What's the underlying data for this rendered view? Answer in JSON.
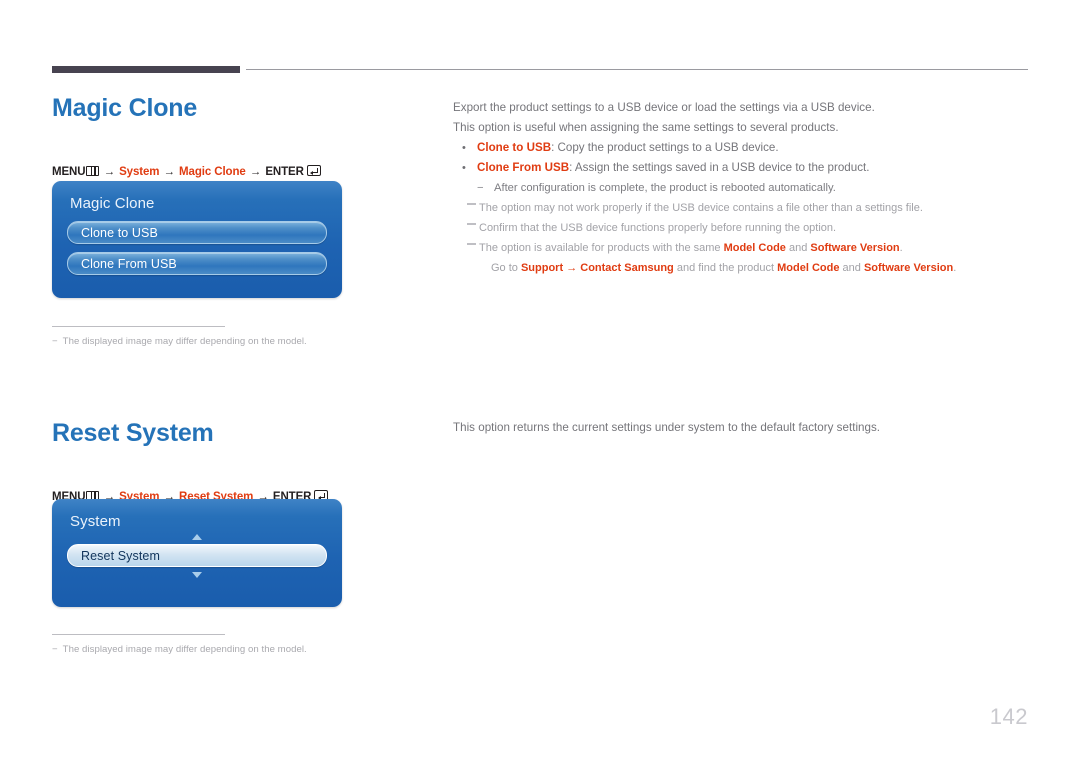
{
  "page": {
    "number": "142"
  },
  "sections": [
    {
      "title": "Magic Clone",
      "menu_path": {
        "menu_label": "MENU",
        "menu_icon": "menu-bars-icon",
        "arrow": "→",
        "step1": "System",
        "step2": "Magic Clone",
        "enter_label": "ENTER",
        "enter_icon": "enter-key-icon"
      },
      "osd": {
        "title": "Magic Clone",
        "items": [
          {
            "label": "Clone to USB",
            "selected": false
          },
          {
            "label": "Clone From USB",
            "selected": false
          }
        ],
        "scroll_up": false,
        "scroll_down": false
      },
      "footnote": "The displayed image may differ depending on the model.",
      "footnote_dash": "−",
      "body": [
        "Export the product settings to a USB device or load the settings via a USB device.",
        "This option is useful when assigning the same settings to several products."
      ],
      "bullets": [
        {
          "term": "Clone to USB",
          "rest": ": Copy the product settings to a USB device."
        },
        {
          "term": "Clone From USB",
          "rest": ": Assign the settings saved in a USB device to the product."
        }
      ],
      "subdash": {
        "mark": "−",
        "text": "After configuration is complete, the product is rebooted automatically."
      },
      "notes": [
        {
          "parts": [
            {
              "t": "The option may not work properly if the USB device contains a file other than a settings file.",
              "em": false
            }
          ]
        },
        {
          "parts": [
            {
              "t": "Confirm that the USB device functions properly before running the option.",
              "em": false
            }
          ]
        },
        {
          "parts": [
            {
              "t": "The option is available for products with the same ",
              "em": false
            },
            {
              "t": "Model Code",
              "em": true
            },
            {
              "t": " and ",
              "em": false
            },
            {
              "t": "Software Version",
              "em": true
            },
            {
              "t": ".",
              "em": false
            }
          ],
          "continuation": [
            {
              "t": "Go to ",
              "em": false
            },
            {
              "t": "Support",
              "em": true
            },
            {
              "t": " → ",
              "em": true
            },
            {
              "t": "Contact Samsung",
              "em": true
            },
            {
              "t": " and find the product ",
              "em": false
            },
            {
              "t": "Model Code",
              "em": true
            },
            {
              "t": " and ",
              "em": false
            },
            {
              "t": "Software Version",
              "em": true
            },
            {
              "t": ".",
              "em": false
            }
          ]
        }
      ]
    },
    {
      "title": "Reset System",
      "menu_path": {
        "menu_label": "MENU",
        "menu_icon": "menu-bars-icon",
        "arrow": "→",
        "step1": "System",
        "step2": "Reset System",
        "enter_label": "ENTER",
        "enter_icon": "enter-key-icon"
      },
      "osd": {
        "title": "System",
        "items": [
          {
            "label": "Reset System",
            "selected": true
          }
        ],
        "scroll_up": true,
        "scroll_down": true
      },
      "footnote": "The displayed image may differ depending on the model.",
      "footnote_dash": "−",
      "body": [
        "This option returns the current settings under system to the default factory settings."
      ],
      "bullets": [],
      "notes": []
    }
  ],
  "colors": {
    "heading_blue": "#2573b8",
    "accent_red": "#e03c12",
    "header_bar": "#474350",
    "osd_blue_top": "#3f83c6",
    "osd_blue_bottom": "#1a5dad",
    "page_number": "#c9c9ce"
  }
}
